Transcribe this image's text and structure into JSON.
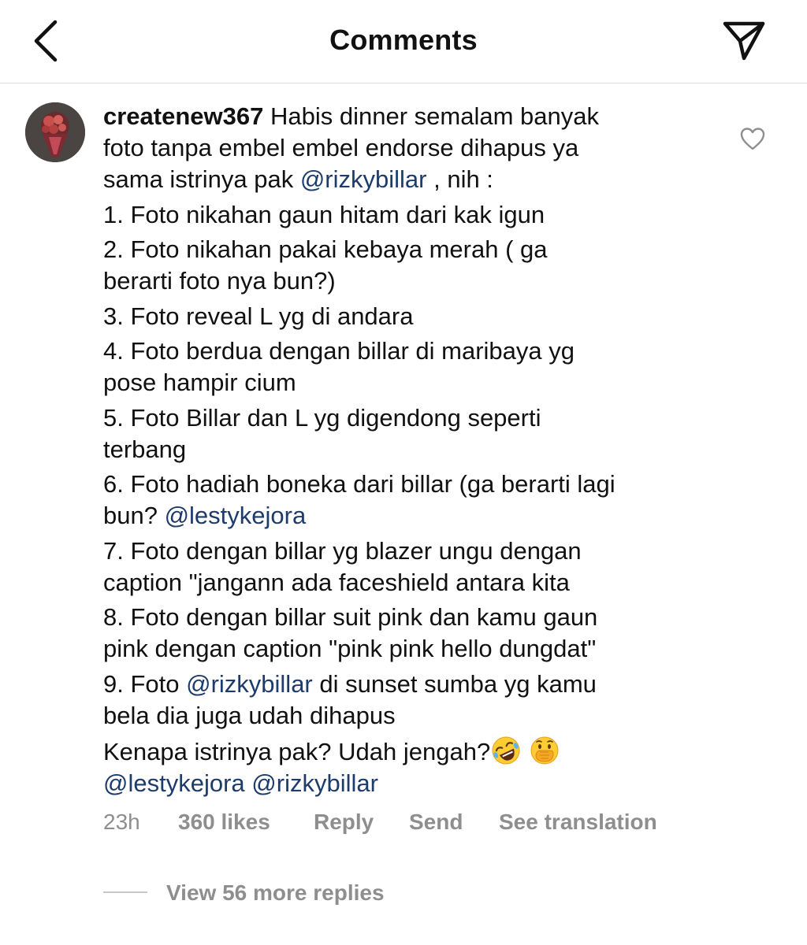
{
  "header": {
    "title": "Comments",
    "back_icon": "chevron-left-icon",
    "send_icon": "paper-plane-icon"
  },
  "comment": {
    "username": "createnew367",
    "text_1": " Habis dinner semalam banyak",
    "text_2": "foto tanpa embel embel endorse dihapus ya",
    "text_3a": "sama istrinya pak ",
    "mention_billar": "@rizkybillar",
    "text_3b": " , nih :",
    "item_1": "1. Foto nikahan gaun hitam dari kak igun",
    "item_2a": "2. Foto nikahan pakai kebaya merah ( ga",
    "item_2b": "berarti foto nya bun?)",
    "item_3": "3. Foto reveal L yg di andara",
    "item_4a": "4. Foto berdua dengan billar di maribaya yg",
    "item_4b": "pose hampir cium",
    "item_5a": "5. Foto Billar dan L yg digendong seperti",
    "item_5b": "terbang",
    "item_6a": "6. Foto hadiah boneka dari billar (ga berarti lagi",
    "item_6b": "bun? ",
    "mention_lesty": "@lestykejora",
    "item_7a": "7. Foto dengan billar yg blazer ungu dengan",
    "item_7b": "caption \"jangann ada faceshield antara kita",
    "item_8a": "8. Foto dengan billar suit pink dan kamu gaun",
    "item_8b": "pink dengan caption \"pink pink hello dungdat\"",
    "item_9a_prefix": "9. Foto ",
    "item_9a_suffix": " di sunset sumba yg kamu",
    "item_9b": "bela dia juga udah dihapus",
    "closing": "Kenapa istrinya pak? Udah jengah?",
    "emoji_1": "rolling-laughing-emoji",
    "emoji_2": "hand-over-mouth-emoji",
    "final_mention_1": "@lestykejora",
    "final_mention_2": "@rizkybillar",
    "like_icon": "heart-outline-icon"
  },
  "meta": {
    "time": "23h",
    "likes": "360 likes",
    "reply": "Reply",
    "send": "Send",
    "translate": "See translation"
  },
  "replies": {
    "label": "View 56 more replies"
  }
}
